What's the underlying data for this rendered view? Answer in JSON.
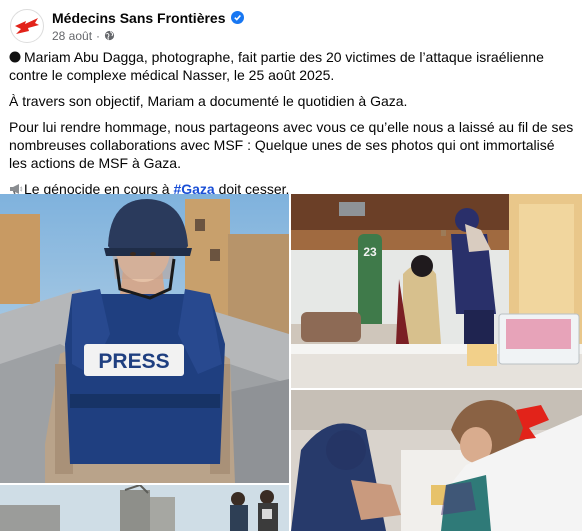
{
  "post": {
    "page_name": "Médecins Sans Frontières",
    "date": "28 août",
    "dot": "·",
    "paragraphs": [
      "Mariam Abu Dagga, photographe, fait partie des 20 victimes de l’attaque israélienne contre le complexe médical Nasser, le 25 août 2025.",
      "À travers son objectif, Mariam a documenté le quotidien à Gaza.",
      "Pour lui rendre hommage, nous partageons avec vous ce qu’elle nous a laissé au fil de ses nombreuses collaborations avec MSF : Quelque unes de ses photos qui ont immortalisé les actions de MSF à Gaza."
    ],
    "last_line_before": "Le génocide en cours à ",
    "hashtag": "#Gaza",
    "last_line_after": " doit cesser."
  },
  "photos": {
    "press_label": "PRESS",
    "oxygen_number": "23"
  },
  "icons": {
    "avatar": "msf-logo-icon",
    "verified": "verified-badge-icon",
    "privacy": "globe-icon",
    "mourning": "black-circle-icon",
    "megaphone": "megaphone-icon"
  },
  "colors": {
    "verified": "#1877f2",
    "hashtag": "#1a4fd6",
    "msf_red": "#e2231a",
    "secondary_text": "#65676b"
  }
}
